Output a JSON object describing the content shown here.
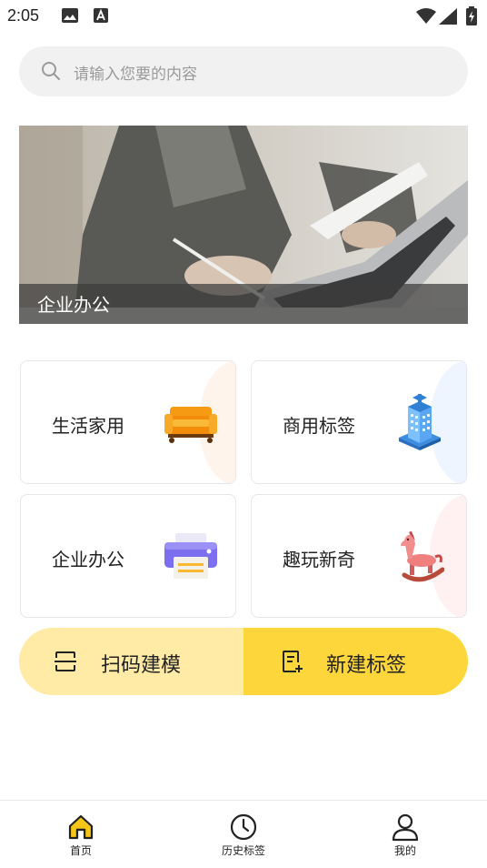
{
  "status_bar": {
    "time": "2:05",
    "icons": [
      "image-icon",
      "a-icon",
      "wifi-icon",
      "signal-icon",
      "battery-icon"
    ]
  },
  "search": {
    "placeholder": "请输入您要的内容"
  },
  "banner": {
    "caption": "企业办公"
  },
  "categories": [
    {
      "label": "生活家用",
      "icon": "sofa-icon",
      "glow": "#fff4ec"
    },
    {
      "label": "商用标签",
      "icon": "building-icon",
      "glow": "#eef5ff"
    },
    {
      "label": "企业办公",
      "icon": "printer-icon",
      "glow": "#ffffff"
    },
    {
      "label": "趣玩新奇",
      "icon": "rocking-horse-icon",
      "glow": "#fff0f2"
    }
  ],
  "actions": {
    "scan": {
      "label": "扫码建模",
      "icon": "scan-icon"
    },
    "new_label": {
      "label": "新建标签",
      "icon": "new-document-icon"
    }
  },
  "tabs": [
    {
      "label": "首页",
      "icon": "home-icon",
      "active": true
    },
    {
      "label": "历史标签",
      "icon": "clock-icon",
      "active": false
    },
    {
      "label": "我的",
      "icon": "user-icon",
      "active": false
    }
  ],
  "colors": {
    "accent_yellow": "#fdd63c",
    "light_yellow": "#ffeaa6",
    "home_icon_active": "#f5c518"
  }
}
